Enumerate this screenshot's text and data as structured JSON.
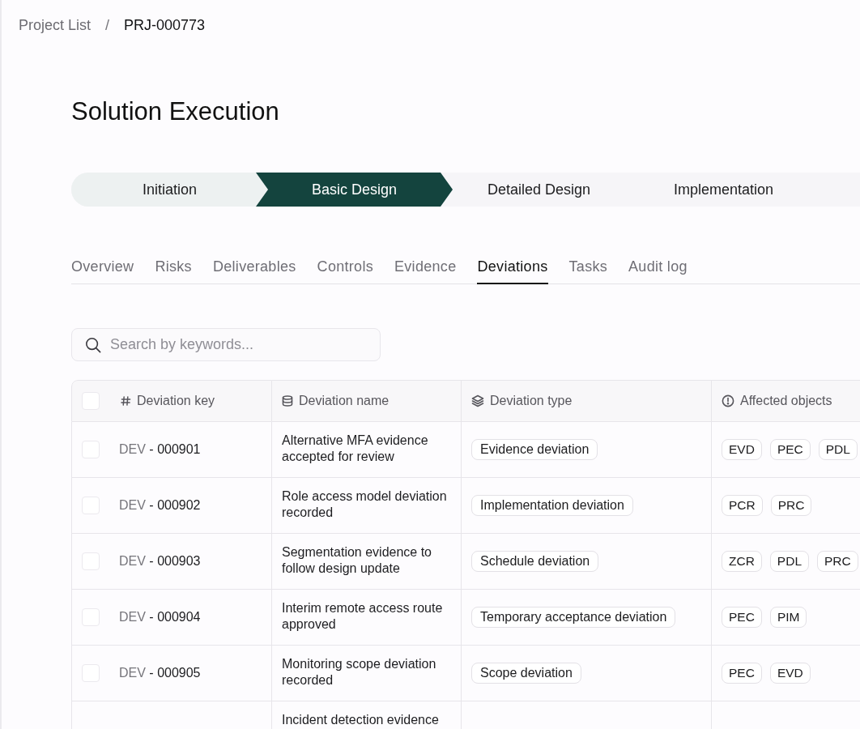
{
  "breadcrumb": {
    "items": [
      {
        "label": "Project List",
        "current": false
      },
      {
        "label": "PRJ-000773",
        "current": true
      }
    ],
    "separator": "/"
  },
  "page_title": "Solution Execution",
  "stages": [
    {
      "label": "Initiation",
      "selected": false
    },
    {
      "label": "Basic Design",
      "selected": true
    },
    {
      "label": "Detailed Design",
      "selected": false
    },
    {
      "label": "Implementation",
      "selected": false
    }
  ],
  "tabs": [
    {
      "label": "Overview",
      "selected": false
    },
    {
      "label": "Risks",
      "selected": false
    },
    {
      "label": "Deliverables",
      "selected": false
    },
    {
      "label": "Controls",
      "selected": false
    },
    {
      "label": "Evidence",
      "selected": false
    },
    {
      "label": "Deviations",
      "selected": true
    },
    {
      "label": "Tasks",
      "selected": false
    },
    {
      "label": "Audit log",
      "selected": false
    }
  ],
  "search": {
    "placeholder": "Search by keywords..."
  },
  "table": {
    "select_all": {
      "checked": false
    },
    "columns": [
      {
        "label": "Deviation key"
      },
      {
        "label": "Deviation name"
      },
      {
        "label": "Deviation type"
      },
      {
        "label": "Affected objects"
      }
    ],
    "rows": [
      {
        "checked": false,
        "key_prefix": "DEV",
        "key_number": "- 000901",
        "name": "Alternative MFA evidence accepted for review",
        "type": "Evidence deviation",
        "objects": [
          "EVD",
          "PEC",
          "PDL"
        ]
      },
      {
        "checked": false,
        "key_prefix": "DEV",
        "key_number": "- 000902",
        "name": "Role access model deviation recorded",
        "type": "Implementation deviation",
        "objects": [
          "PCR",
          "PRC"
        ]
      },
      {
        "checked": false,
        "key_prefix": "DEV",
        "key_number": "- 000903",
        "name": "Segmentation evidence to follow design update",
        "type": "Schedule deviation",
        "objects": [
          "ZCR",
          "PDL",
          "PRC"
        ]
      },
      {
        "checked": false,
        "key_prefix": "DEV",
        "key_number": "- 000904",
        "name": "Interim remote access route approved",
        "type": "Temporary acceptance deviation",
        "objects": [
          "PEC",
          "PIM"
        ]
      },
      {
        "checked": false,
        "key_prefix": "DEV",
        "key_number": "- 000905",
        "name": "Monitoring scope deviation recorded",
        "type": "Scope deviation",
        "objects": [
          "PEC",
          "EVD"
        ]
      },
      {
        "name": "Incident detection evidence"
      }
    ]
  }
}
